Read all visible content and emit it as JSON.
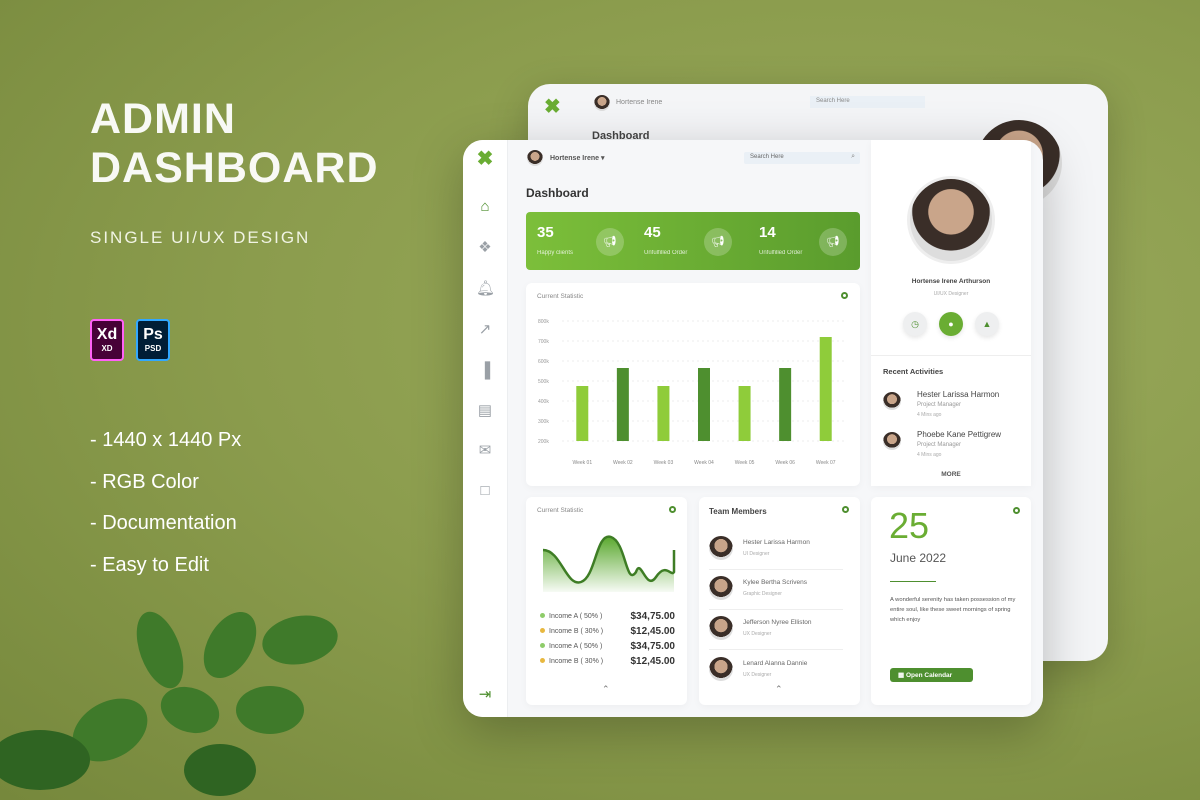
{
  "promo": {
    "title_line1": "ADMIN",
    "title_line2": "DASHBOARD",
    "subtitle": "SINGLE UI/UX DESIGN",
    "badges": [
      {
        "label": "Xd",
        "sub": "XD",
        "color": "#470137"
      },
      {
        "label": "Ps",
        "sub": "PSD",
        "color": "#001e36"
      }
    ],
    "features": [
      "- 1440 x 1440 Px",
      "- RGB Color",
      "- Documentation",
      "- Easy to Edit"
    ]
  },
  "header": {
    "user_name": "Hortense Irene",
    "search_placeholder": "Search Here"
  },
  "back_header": {
    "user_name": "Hortense Irene",
    "search_placeholder": "Search Here",
    "title": "Dashboard"
  },
  "page_title": "Dashboard",
  "stats": [
    {
      "value": "35",
      "label": "Happy clients"
    },
    {
      "value": "45",
      "label": "Unfulfilled Order"
    },
    {
      "value": "14",
      "label": "Unfulfilled Order"
    }
  ],
  "accent": "#6aad33",
  "chart_data": {
    "type": "bar",
    "title": "Current Statistic",
    "categories": [
      "Week 01",
      "Week 02",
      "Week 03",
      "Week 04",
      "Week 05",
      "Week 06",
      "Week 07"
    ],
    "values": [
      475,
      565,
      475,
      565,
      475,
      565,
      720
    ],
    "ytick_labels": [
      "800k",
      "700k",
      "600k",
      "500k",
      "400k",
      "300k",
      "200k"
    ],
    "ylim": [
      200,
      800
    ],
    "grid": true,
    "colors": [
      "#8fcc3a",
      "#4e8f2f",
      "#8fcc3a",
      "#4e8f2f",
      "#8fcc3a",
      "#4e8f2f",
      "#8fcc3a"
    ]
  },
  "income": {
    "title": "Current Statistic",
    "items": [
      {
        "label": "Income A ( 50% )",
        "amount": "$34,75.00",
        "color": "#8fcc6a"
      },
      {
        "label": "Income B ( 30% )",
        "amount": "$12,45.00",
        "color": "#e8b840"
      },
      {
        "label": "Income A ( 50% )",
        "amount": "$34,75.00",
        "color": "#8fcc6a"
      },
      {
        "label": "Income B ( 30% )",
        "amount": "$12,45.00",
        "color": "#e8b840"
      }
    ]
  },
  "team": {
    "title": "Team Members",
    "members": [
      {
        "name": "Hester Larissa Harmon",
        "role": "UI Designer"
      },
      {
        "name": "Kylee Bertha Scrivens",
        "role": "Graphic Designer"
      },
      {
        "name": "Jefferson Nyree Elliston",
        "role": "UX Designer"
      },
      {
        "name": "Lenard Alanna Dannie",
        "role": "UX Designer"
      }
    ]
  },
  "profile": {
    "name": "Hortense Irene Arthurson",
    "role": "UI/UX Designer"
  },
  "activities": {
    "title": "Recent Activities",
    "items": [
      {
        "name": "Hester Larissa Harmon",
        "role": "Project Manager",
        "time": "4 Mins ago"
      },
      {
        "name": "Phoebe Kane Pettigrew",
        "role": "Project Manager",
        "time": "4 Mins ago"
      }
    ],
    "more": "MORE"
  },
  "calendar": {
    "day": "25",
    "month_year": "June 2022",
    "note": "A wonderful serenity has taken possession of my entire soul, like these sweet mornings of spring which enjoy",
    "button": "Open Calendar"
  }
}
